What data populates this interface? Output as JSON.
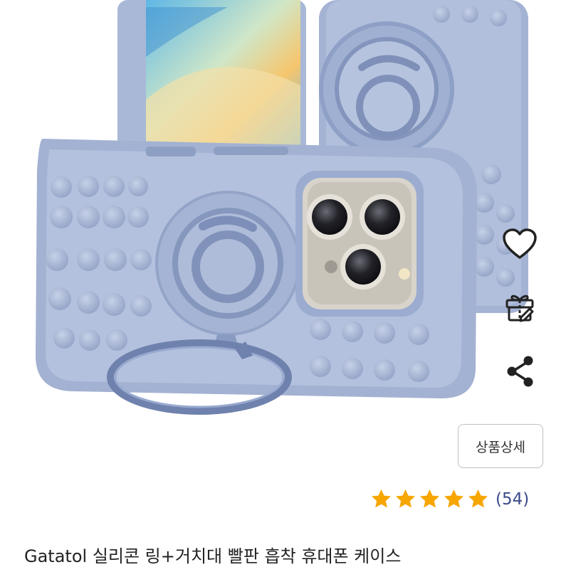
{
  "product": {
    "title": "Gatatol 실리콘 링+거치대 빨판 흡착 휴대폰 케이스",
    "image_alt": "Gatatol silicone ring stand suction phone case",
    "detail_button_label": "상품상세",
    "rating": {
      "stars": 5,
      "review_count": "(54)"
    }
  },
  "actions": {
    "wishlist_icon": "heart-icon",
    "gift_icon": "gift-icon",
    "share_icon": "share-icon"
  },
  "colors": {
    "star": "#f7a600",
    "review_count": "#3b4a8a",
    "case": "#a7b6d6"
  }
}
